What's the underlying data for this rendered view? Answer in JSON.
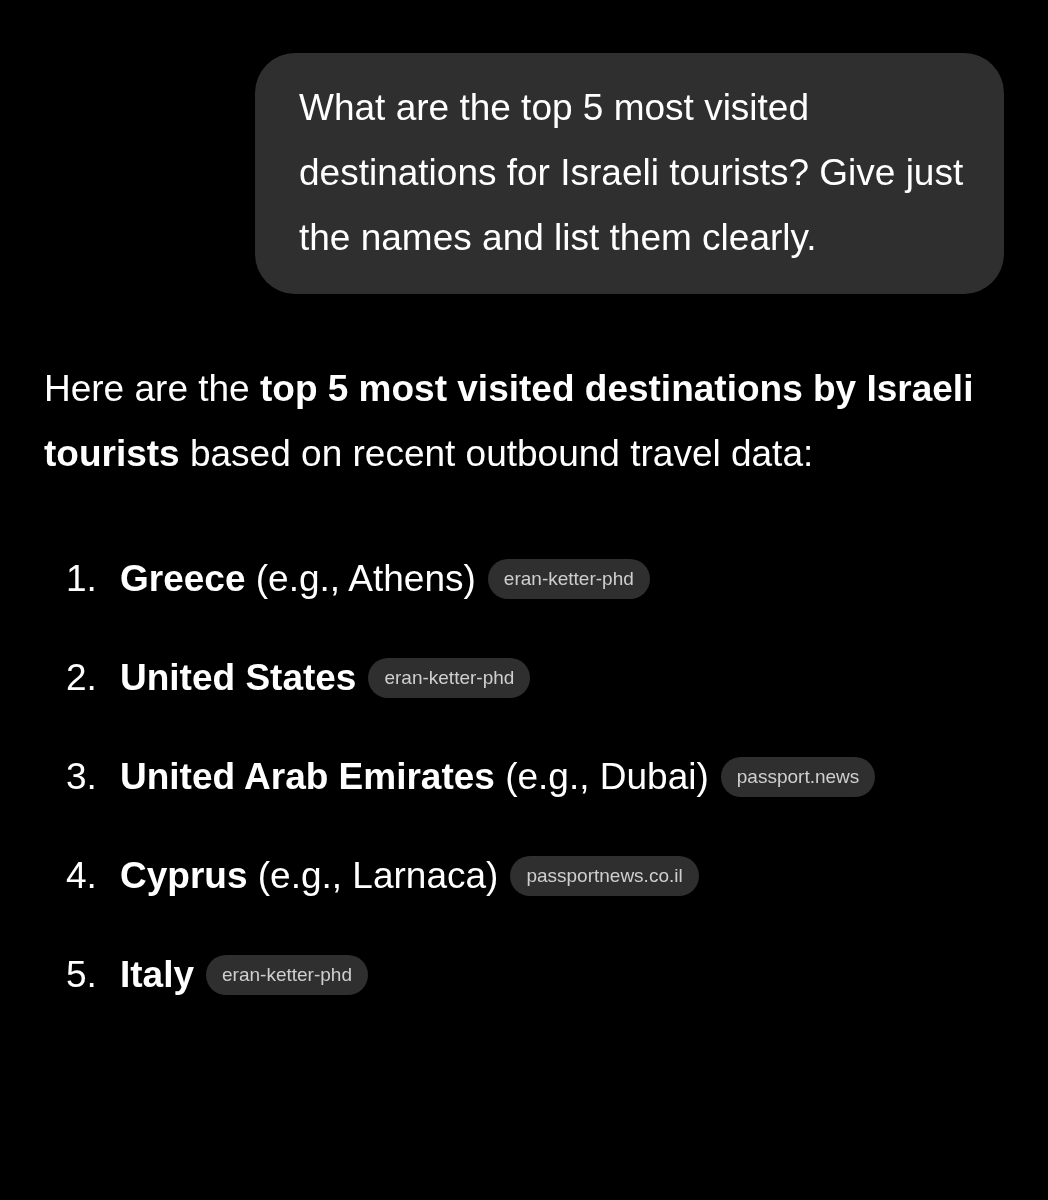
{
  "user_message": {
    "text": "What are the top 5 most visited destinations for Israeli tourists? Give just the names and list them clearly."
  },
  "response": {
    "intro": "Here are the **top 5 most visited destinations by Israeli tourists** based on recent outbound travel data:",
    "items": [
      {
        "number": "1.",
        "text": "**Greece** (e.g., Athens)",
        "source": "eran-ketter-phd"
      },
      {
        "number": "2.",
        "text": "**United States**",
        "source": "eran-ketter-phd"
      },
      {
        "number": "3.",
        "text": "**United Arab Emirates** (e.g., Dubai)",
        "source": "passport.news"
      },
      {
        "number": "4.",
        "text": "**Cyprus** (e.g., Larnaca)",
        "source": "passportnews.co.il"
      },
      {
        "number": "5.",
        "text": "**Italy**",
        "source": "eran-ketter-phd"
      }
    ]
  }
}
